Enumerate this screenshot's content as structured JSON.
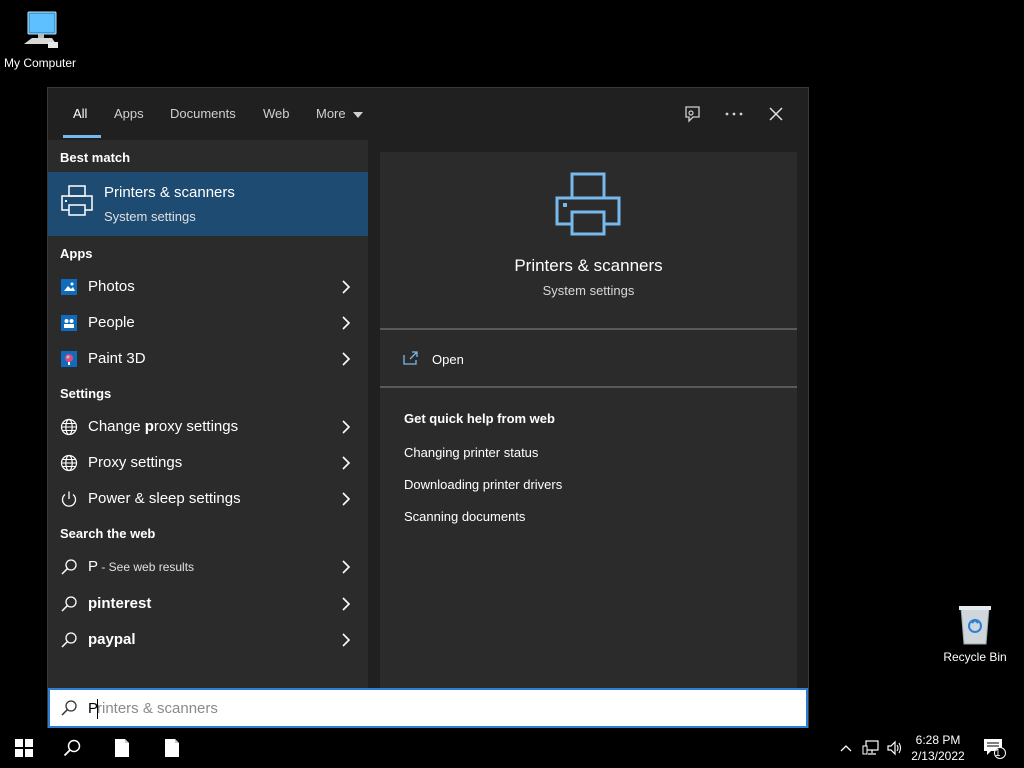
{
  "desktop": {
    "my_computer_label": "My Computer",
    "recycle_bin_label": "Recycle Bin"
  },
  "search_tabs": {
    "all": "All",
    "apps": "Apps",
    "documents": "Documents",
    "web": "Web",
    "more": "More"
  },
  "left": {
    "best_match_header": "Best match",
    "best_match": {
      "title": "Printers & scanners",
      "subtitle": "System settings",
      "icon": "printer-icon"
    },
    "apps_header": "Apps",
    "apps": [
      {
        "label": "Photos",
        "icon": "photos-icon"
      },
      {
        "label": "People",
        "icon": "people-icon"
      },
      {
        "label": "Paint 3D",
        "icon": "paint3d-icon"
      }
    ],
    "settings_header": "Settings",
    "settings": [
      {
        "label_pre": "Change ",
        "label_bold": "p",
        "label_post": "roxy settings",
        "icon": "globe-icon"
      },
      {
        "label": "Proxy settings",
        "icon": "globe-icon"
      },
      {
        "label": "Power & sleep settings",
        "icon": "power-icon"
      }
    ],
    "web_header": "Search the web",
    "web": [
      {
        "label": "P",
        "suffix": " - See web results",
        "icon": "search-icon"
      },
      {
        "label": "pinterest",
        "icon": "search-icon"
      },
      {
        "label": "paypal",
        "icon": "search-icon"
      }
    ]
  },
  "right": {
    "title": "Printers & scanners",
    "subtitle": "System settings",
    "open_label": "Open",
    "help_header": "Get quick help from web",
    "help_links": [
      "Changing printer status",
      "Downloading printer drivers",
      "Scanning documents"
    ]
  },
  "search_box": {
    "typed": "P",
    "suggestion": "rinters & scanners"
  },
  "taskbar": {
    "time": "6:28 PM",
    "date": "2/13/2022",
    "notification_count": "1"
  },
  "colors": {
    "accent": "#76b9ed",
    "selection": "#1e4b72",
    "panel": "#2b2b2b"
  }
}
